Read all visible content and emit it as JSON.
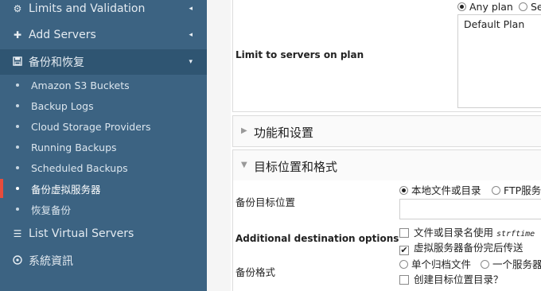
{
  "sidebar": {
    "items": [
      {
        "icon": "gear-icon",
        "label": "Limits and Validation",
        "caret": "◂"
      },
      {
        "icon": "plus-icon",
        "label": "Add Servers",
        "caret": "◂"
      },
      {
        "icon": "save-icon",
        "label": "备份和恢复",
        "caret": "▾"
      }
    ],
    "sub_items": [
      "Amazon S3 Buckets",
      "Backup Logs",
      "Cloud Storage Providers",
      "Running Backups",
      "Scheduled Backups",
      "备份虚拟服务器",
      "恢复备份"
    ],
    "bottom_items": [
      {
        "icon": "list-icon",
        "label": "List Virtual Servers"
      },
      {
        "icon": "info-circle-icon",
        "label": "系統資訊"
      }
    ]
  },
  "plan": {
    "label": "Limit to servers on plan",
    "opt_any": "Any plan",
    "opt_sel": "Se",
    "list_value": "Default Plan"
  },
  "sections": {
    "features": "功能和设置",
    "dest": "目标位置和格式"
  },
  "dest": {
    "label": "备份目标位置",
    "opt_local": "本地文件或目录",
    "opt_ftp": "FTP服务"
  },
  "additional": {
    "label": "Additional destination options",
    "opt1_prefix": "文件或目录名使用",
    "opt1_mono": "strftime",
    "opt2": "虚拟服务器备份完后传送"
  },
  "format": {
    "label": "备份格式",
    "opt_single": "单个归档文件",
    "opt_each": "一个服务器",
    "opt_create": "创建目标位置目录？"
  },
  "colors": {
    "sidebar_bg": "#3c6382",
    "active_bg": "#2f5572",
    "current_marker": "#e74c3c"
  }
}
